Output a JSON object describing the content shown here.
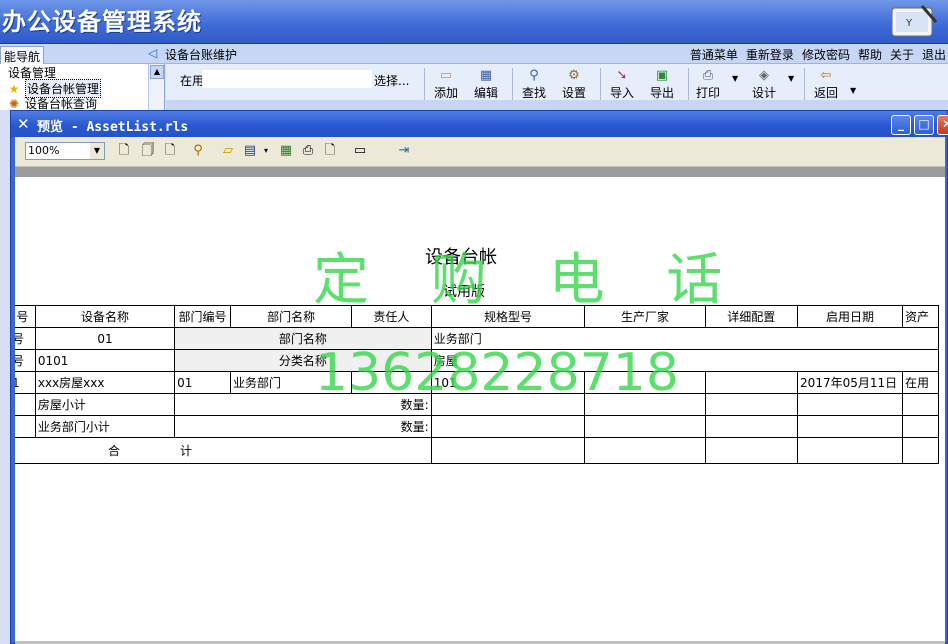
{
  "app": {
    "title": "办公设备管理系统"
  },
  "nav": {
    "tab": "能导航",
    "section": "设备台账维护",
    "menu": [
      "普通菜单",
      "重新登录",
      "修改密码",
      "帮助",
      "关于",
      "退出"
    ]
  },
  "sidebar": {
    "head": "设备管理",
    "items": [
      {
        "icon": "star-icon",
        "label": "设备台帐管理"
      },
      {
        "icon": "gear-icon",
        "label": "设备台帐查询"
      }
    ]
  },
  "filter": {
    "label": "在用",
    "value": "",
    "select_label": "选择..."
  },
  "toolbar": [
    {
      "icon": "add-icon",
      "label": "添加"
    },
    {
      "icon": "edit-icon",
      "label": "编辑"
    },
    {
      "icon": "binoculars-icon",
      "label": "查找"
    },
    {
      "icon": "settings-icon",
      "label": "设置"
    },
    {
      "icon": "import-icon",
      "label": "导入"
    },
    {
      "icon": "export-icon",
      "label": "导出"
    },
    {
      "icon": "print-icon",
      "label": "打印"
    },
    {
      "icon": "design-icon",
      "label": "设计"
    },
    {
      "icon": "back-icon",
      "label": "返回"
    }
  ],
  "preview": {
    "title": "预览 - AssetList.rls",
    "zoom": "100%"
  },
  "report": {
    "watermark_top": "定 购 电 话",
    "watermark_bottom": "13628228718",
    "title": "设备台帐",
    "subtitle": "试用版",
    "headers": [
      "号",
      "设备名称",
      "部门编号",
      "部门名称",
      "责任人",
      "规格型号",
      "生产厂家",
      "详细配置",
      "启用日期",
      "资产"
    ],
    "group_dept": {
      "no": "号",
      "code": "01",
      "label": "部门名称",
      "value": "业务部门"
    },
    "group_cat": {
      "no": "号",
      "code": "0101",
      "label": "分类名称",
      "value": "房屋"
    },
    "row": {
      "no": "1",
      "name": "xxx房屋xxx",
      "dept_code": "01",
      "dept_name": "业务部门",
      "model": "101",
      "start_date": "2017年05月11日",
      "status": "在用"
    },
    "subtotal_cat": {
      "label": "房屋小计",
      "qty_label": "数量:"
    },
    "subtotal_dept": {
      "label": "业务部门小计",
      "qty_label": "数量:"
    },
    "total": {
      "a": "合",
      "b": "计"
    }
  },
  "colors": {
    "accent": "#2a58d0",
    "watermark": "#35d84b"
  }
}
